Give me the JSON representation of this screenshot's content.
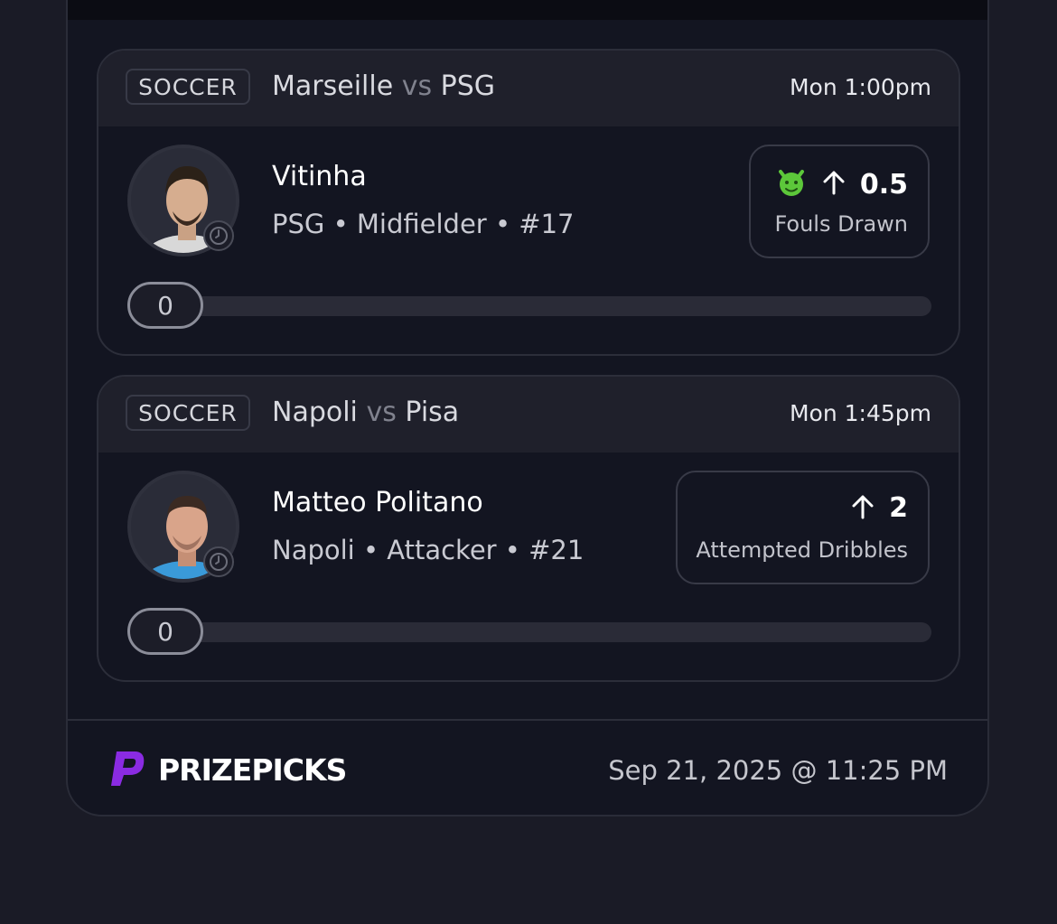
{
  "picks": [
    {
      "sport": "SOCCER",
      "team_a": "Marseille",
      "vs": "vs",
      "team_b": "PSG",
      "time": "Mon 1:00pm",
      "player_name": "Vitinha",
      "player_meta": "PSG • Midfielder • #17",
      "direction_icon": "arrow-up-icon",
      "line": "0.5",
      "stat": "Fouls Drawn",
      "has_demon": true,
      "progress_value": "0"
    },
    {
      "sport": "SOCCER",
      "team_a": "Napoli",
      "vs": "vs",
      "team_b": "Pisa",
      "time": "Mon 1:45pm",
      "player_name": "Matteo Politano",
      "player_meta": "Napoli • Attacker • #21",
      "direction_icon": "arrow-up-icon",
      "line": "2",
      "stat": "Attempted Dribbles",
      "has_demon": false,
      "progress_value": "0"
    }
  ],
  "footer": {
    "brand": "PRIZEPICKS",
    "timestamp": "Sep 21, 2025 @ 11:25 PM"
  },
  "colors": {
    "background": "#1a1b26",
    "card": "#131521",
    "card_header": "#1f202b",
    "brand_purple": "#8a2be2",
    "demon_green": "#5cc73a"
  }
}
